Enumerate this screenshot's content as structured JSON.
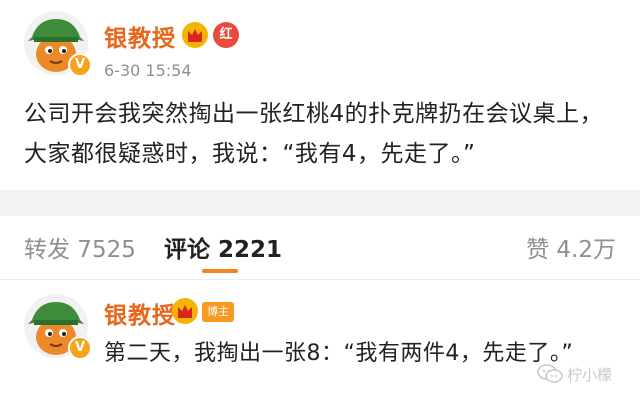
{
  "post": {
    "username": "银教授",
    "badge_text": "红",
    "verified_mark": "V",
    "timestamp": "6-30 15:54",
    "text": "公司开会我突然掏出一张红桃4的扑克牌扔在会议桌上，大家都很疑惑时，我说：“我有4，先走了。”"
  },
  "tabs": {
    "repost": "转发 7525",
    "comment": "评论 2221",
    "like": "赞 4.2万"
  },
  "comment": {
    "username": "银教授",
    "host_badge": "博主",
    "verified_mark": "V",
    "text": "第二天，我掏出一张8：“我有两件4，先走了。”"
  },
  "watermark": {
    "text": "柠小檬"
  },
  "colors": {
    "username": "#e8671c",
    "accent": "#f58220",
    "verified": "#f6a41b",
    "red_badge": "#e94a3e"
  },
  "icons": [
    "avatar-cartoon-icon",
    "crown-icon",
    "verified-v-icon",
    "wechat-icon"
  ]
}
